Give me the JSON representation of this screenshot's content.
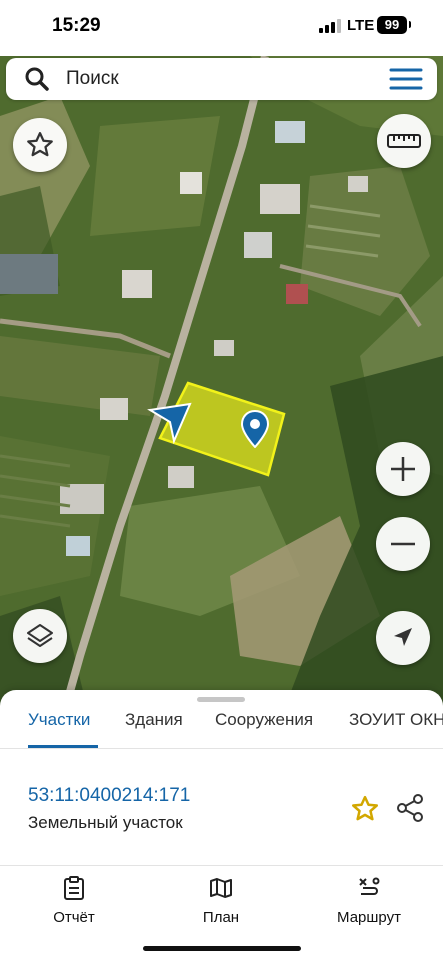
{
  "status_bar": {
    "time": "15:29",
    "network": "LTE",
    "battery": "99"
  },
  "search": {
    "placeholder": "Поиск"
  },
  "map": {
    "accent_color": "#1565a7",
    "parcel_fill": "#f2f21a",
    "controls": [
      "favorite-star-icon",
      "ruler-icon",
      "zoom-in-icon",
      "zoom-out-icon",
      "layers-icon",
      "locate-arrow-icon"
    ]
  },
  "sheet": {
    "tabs": [
      {
        "label": "Участки"
      },
      {
        "label": "Здания"
      },
      {
        "label": "Сооружения"
      },
      {
        "label": "ЗОУИТ ОКН"
      }
    ],
    "parcel": {
      "number": "53:11:0400214:171",
      "type": "Земельный участок"
    }
  },
  "bottom_nav": [
    {
      "label": "Отчёт"
    },
    {
      "label": "План"
    },
    {
      "label": "Маршрут"
    }
  ]
}
